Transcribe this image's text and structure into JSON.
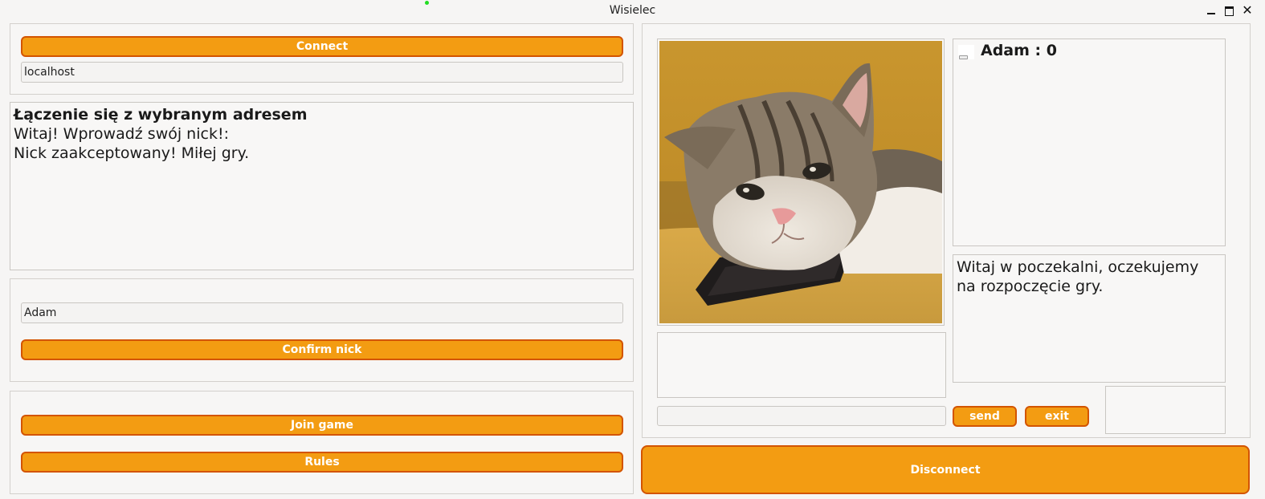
{
  "window": {
    "title": "Wisielec",
    "minimize_icon": "minimize-icon",
    "maximize_icon": "maximize-icon",
    "close_icon": "close-icon",
    "close_glyph": "✕"
  },
  "connection": {
    "connect_label": "Connect",
    "address_value": "localhost"
  },
  "log": {
    "lines": [
      "Łączenie się z wybranym adresem",
      "Witaj! Wprowadź swój nick!:",
      "Nick zaakceptowany! Miłej gry."
    ]
  },
  "nick": {
    "value": "Adam",
    "confirm_label": "Confirm nick"
  },
  "game_menu": {
    "join_label": "Join game",
    "rules_label": "Rules"
  },
  "game": {
    "image": "cat-lying-on-phone-image",
    "word_display": "",
    "guess_value": "",
    "players": [
      {
        "label": "Adam : 0"
      }
    ],
    "lobby_message": "Witaj w poczekalni, oczekujemy na rozpoczęcie gry.",
    "send_label": "send",
    "exit_label": "exit",
    "disconnect_label": "Disconnect"
  },
  "colors": {
    "button_fill": "#f39c12",
    "button_border": "#d35400",
    "button_text": "#ffffff",
    "background": "#f6f5f4"
  }
}
